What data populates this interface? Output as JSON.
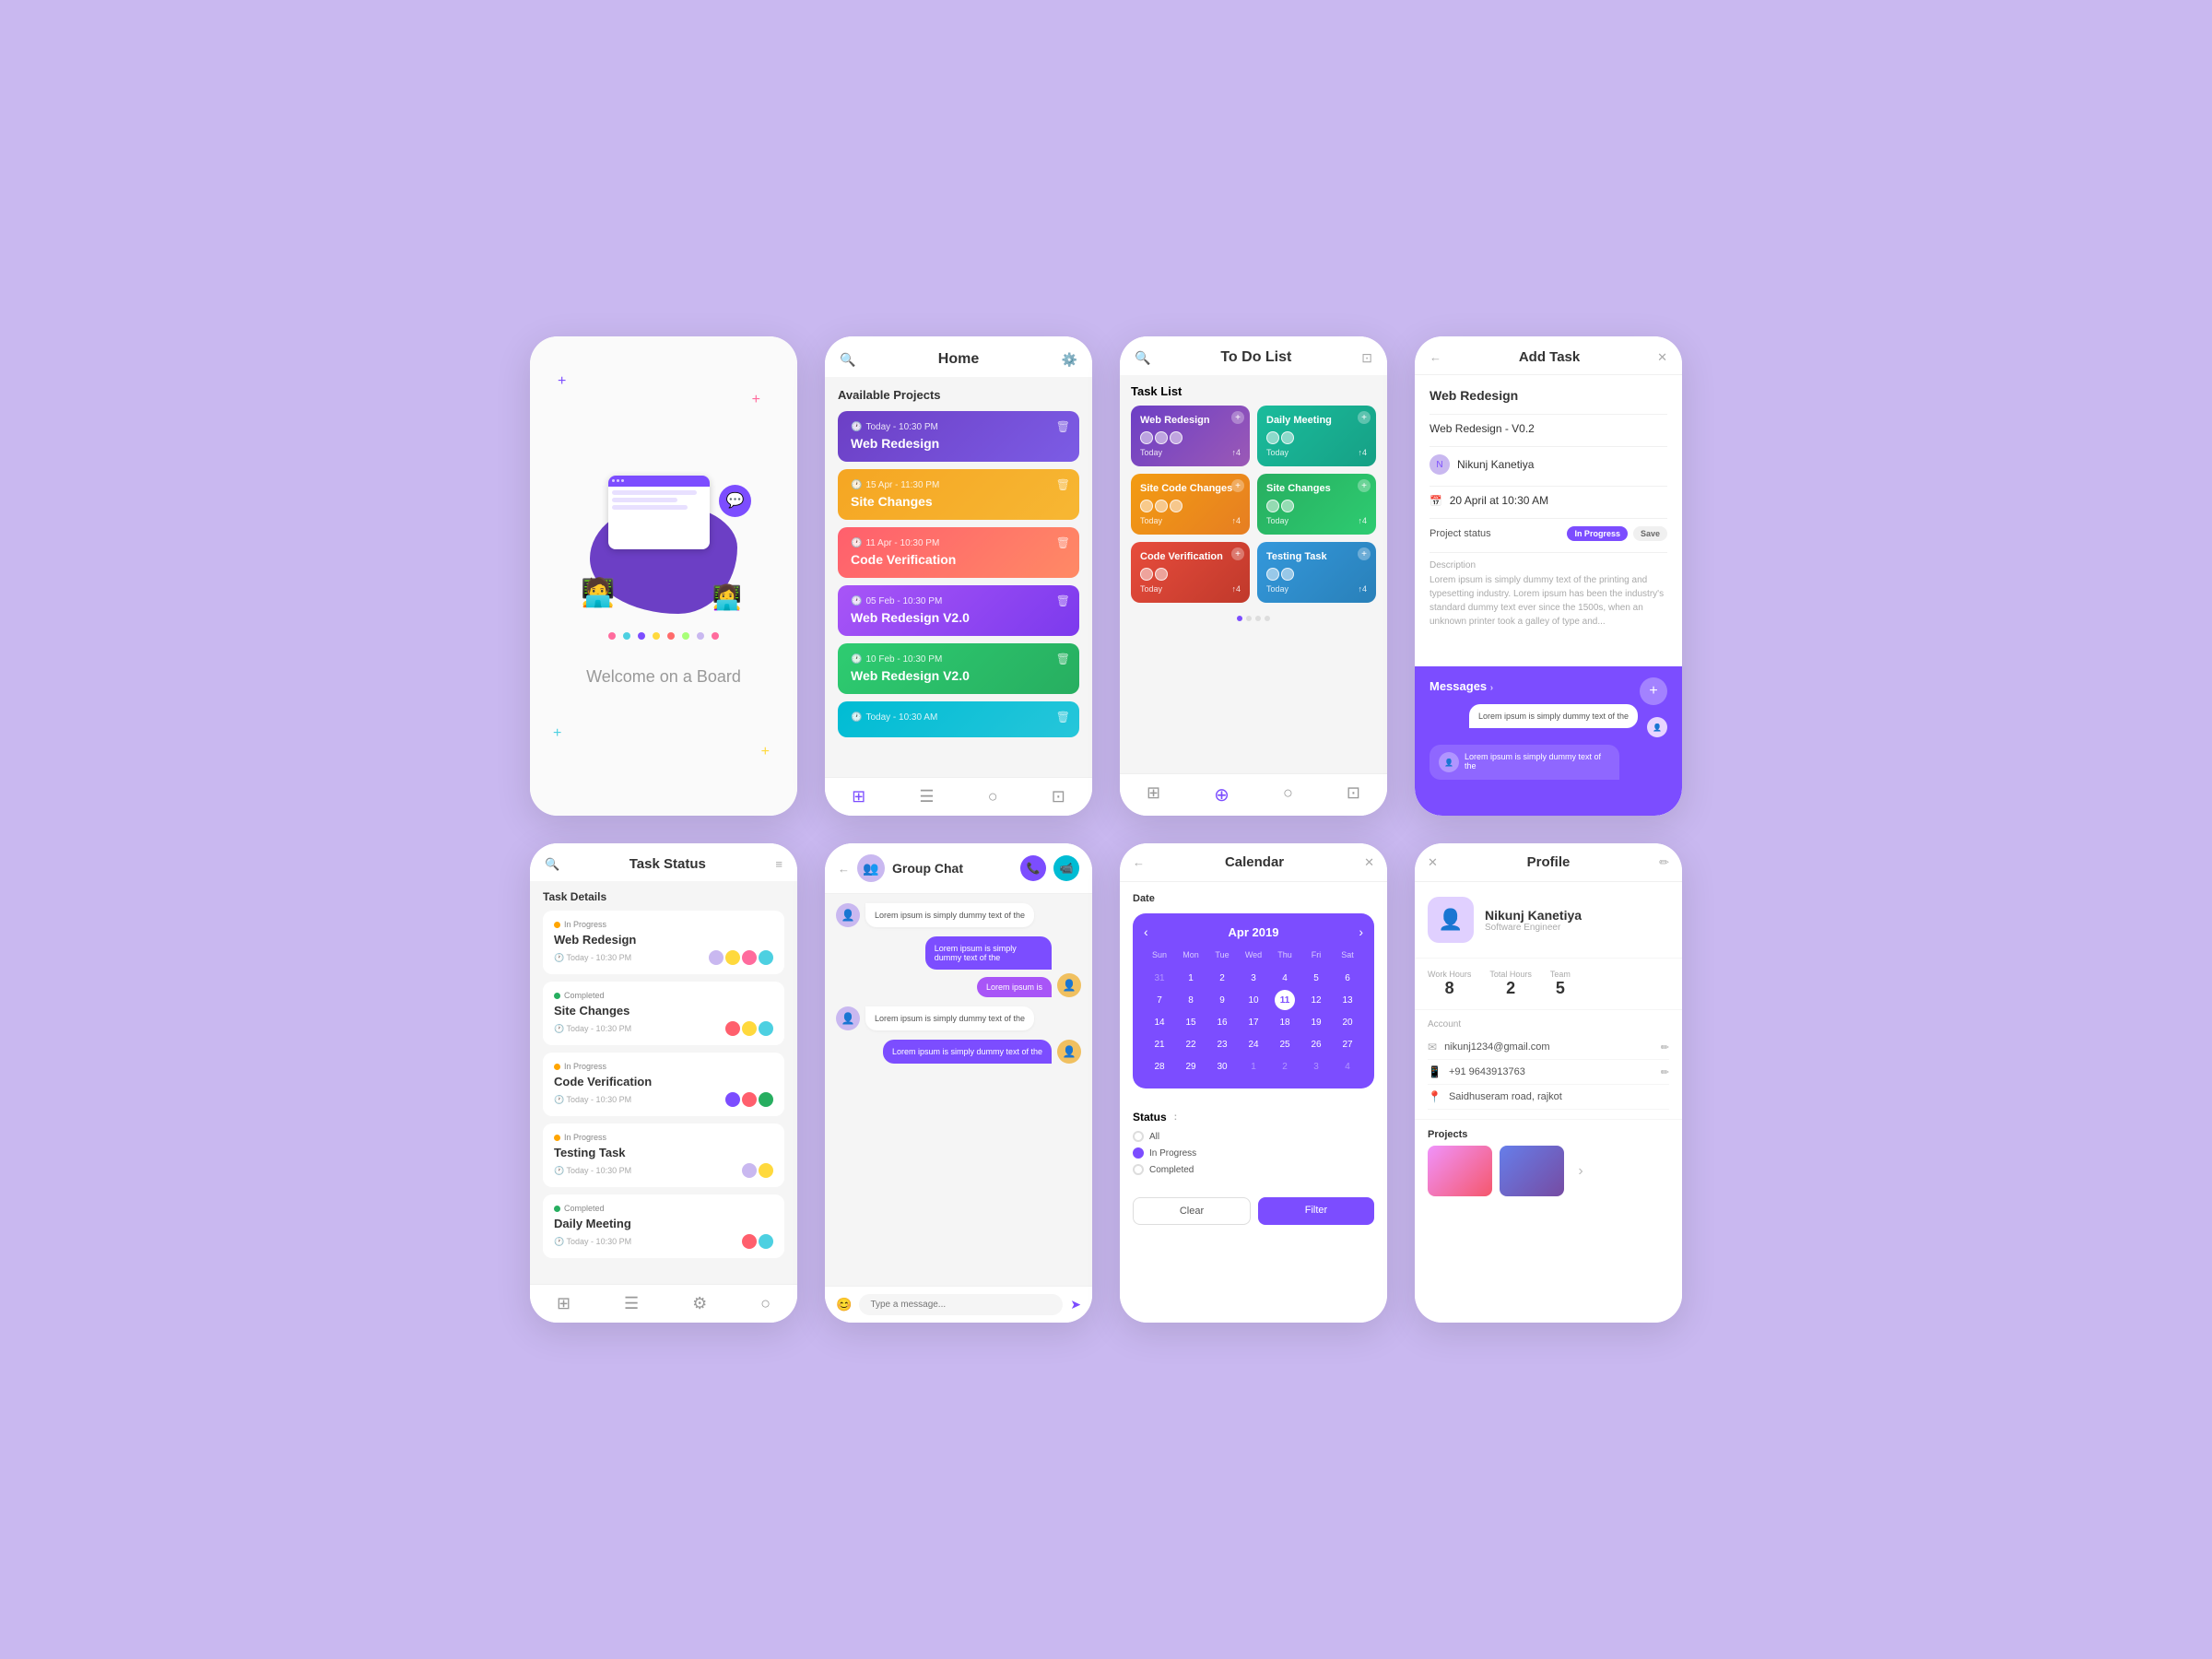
{
  "bg": "#c9b8f0",
  "accent": "#7c4dff",
  "cards": {
    "welcome": {
      "text": "Welcome on a Board",
      "dots": [
        {
          "color": "#ff6b9d"
        },
        {
          "color": "#7c4dff"
        },
        {
          "color": "#ffd93d"
        },
        {
          "color": "#4dd0e1"
        },
        {
          "color": "#a8ff78"
        },
        {
          "color": "#ff6b6b"
        },
        {
          "color": "#7c4dff"
        },
        {
          "color": "#ffd93d"
        },
        {
          "color": "#4dd0e1"
        }
      ]
    },
    "home": {
      "title": "Home",
      "section": "Available Projects",
      "projects": [
        {
          "title": "Web Redesign",
          "time": "Today - 10:30 PM",
          "color": "pc-blue"
        },
        {
          "title": "Site Changes",
          "time": "15 Apr - 11:30 PM",
          "color": "pc-orange"
        },
        {
          "title": "Code Verification",
          "time": "11 Apr - 10:30 PM",
          "color": "pc-red"
        },
        {
          "title": "Web Redesign V2.0",
          "time": "05 Feb - 10:30 PM",
          "color": "pc-purple"
        },
        {
          "title": "Web Redesign V2.0",
          "time": "10 Feb - 10:30 PM",
          "color": "pc-green"
        },
        {
          "title": "",
          "time": "Today - 10:30 AM",
          "color": "pc-teal"
        }
      ]
    },
    "todo": {
      "title": "To Do List",
      "section": "Task List",
      "tasks": [
        {
          "title": "Web Redesign",
          "color": "tt-blue"
        },
        {
          "title": "Daily Meeting",
          "color": "tt-teal"
        },
        {
          "title": "Site Code Changes",
          "color": "tt-orange"
        },
        {
          "title": "Site Changes",
          "color": "tt-green"
        },
        {
          "title": "Code Verification",
          "color": "tt-red"
        },
        {
          "title": "Testing Task",
          "color": "tt-lightblue"
        }
      ]
    },
    "addtask": {
      "title": "Add Task",
      "task_name": "Web Redesign",
      "subtask": "Web Redesign - V0.2",
      "assignee": "Nikunj Kanetiya",
      "date": "20 April at 10:30 AM",
      "project_status_label": "Project status",
      "status_badge": "In Progress",
      "save_label": "Save",
      "description_label": "Description",
      "description_text": "Lorem ipsum is simply dummy text of the printing and typesetting industry. Lorem ipsum has been the industry's standard dummy text ever since the 1500s, when an unknown printer took a galley of type and...",
      "messages_title": "Messages",
      "msg1": "Lorem ipsum is simply dummy text of the",
      "msg2": "Lorem ipsum is simply dummy text of the"
    },
    "taskstatus": {
      "header_title": "Task Status",
      "section": "Task Details",
      "tasks": [
        {
          "status": "In Progress",
          "status_color": "#ffa500",
          "name": "Web Redesign",
          "time": "Today - 10:30 PM"
        },
        {
          "status": "Completed",
          "status_color": "#27ae60",
          "name": "Site Changes",
          "time": "Today - 10:30 PM"
        },
        {
          "status": "In Progress",
          "status_color": "#ffa500",
          "name": "Code Verification",
          "time": "Today - 10:30 PM"
        },
        {
          "status": "In Progress",
          "status_color": "#ffa500",
          "name": "Testing Task",
          "time": "Today - 10:30 PM"
        },
        {
          "status": "Completed",
          "status_color": "#27ae60",
          "name": "Daily Meeting",
          "time": "Today - 10:30 PM"
        }
      ]
    },
    "groupchat": {
      "title": "Group Chat",
      "messages": [
        {
          "side": "left",
          "text": "Lorem ipsum is simply dummy text of the"
        },
        {
          "side": "right",
          "text": "Lorem ipsum is simply dummy text of the",
          "sub": "Lorem ipsum is"
        },
        {
          "side": "left",
          "text": "Lorem ipsum is simply dummy text of the"
        },
        {
          "side": "right",
          "text": "Lorem ipsum is simply dummy text of the"
        },
        {
          "side": "right-sub",
          "text": "Lorem ipsum is"
        }
      ],
      "input_placeholder": "Type a message..."
    },
    "calendar": {
      "title": "Calendar",
      "date_label": "Date",
      "month": "Apr 2019",
      "weekdays": [
        "Sun",
        "Mon",
        "Tue",
        "Wed",
        "Thu",
        "Fri",
        "Sat"
      ],
      "days_prev": [
        31,
        1,
        2,
        3,
        4,
        5,
        6
      ],
      "weeks": [
        [
          7,
          8,
          9,
          10,
          11,
          12,
          13
        ],
        [
          14,
          15,
          16,
          17,
          18,
          19,
          20
        ],
        [
          21,
          22,
          23,
          24,
          25,
          26,
          27
        ],
        [
          28,
          29,
          30,
          1,
          2,
          3,
          4
        ]
      ],
      "today": 11,
      "status_label": "Status",
      "status_options": [
        "All",
        "In Progress",
        "Completed"
      ],
      "selected_status": "In Progress",
      "btn_clear": "Clear",
      "btn_filter": "Filter"
    },
    "profile": {
      "title": "Profile",
      "name": "Nikunj Kanetiya",
      "role": "Software Engineer",
      "stats": [
        {
          "label": "Work Hours",
          "value": "8"
        },
        {
          "label": "Total Hours",
          "value": "2"
        },
        {
          "label": "Team",
          "value": "5"
        }
      ],
      "account_section": "Account",
      "email": "nikunj1234@gmail.com",
      "phone": "+91 9643913763",
      "address": "Saidhuseram road, rajkot",
      "projects_label": "Projects"
    }
  }
}
